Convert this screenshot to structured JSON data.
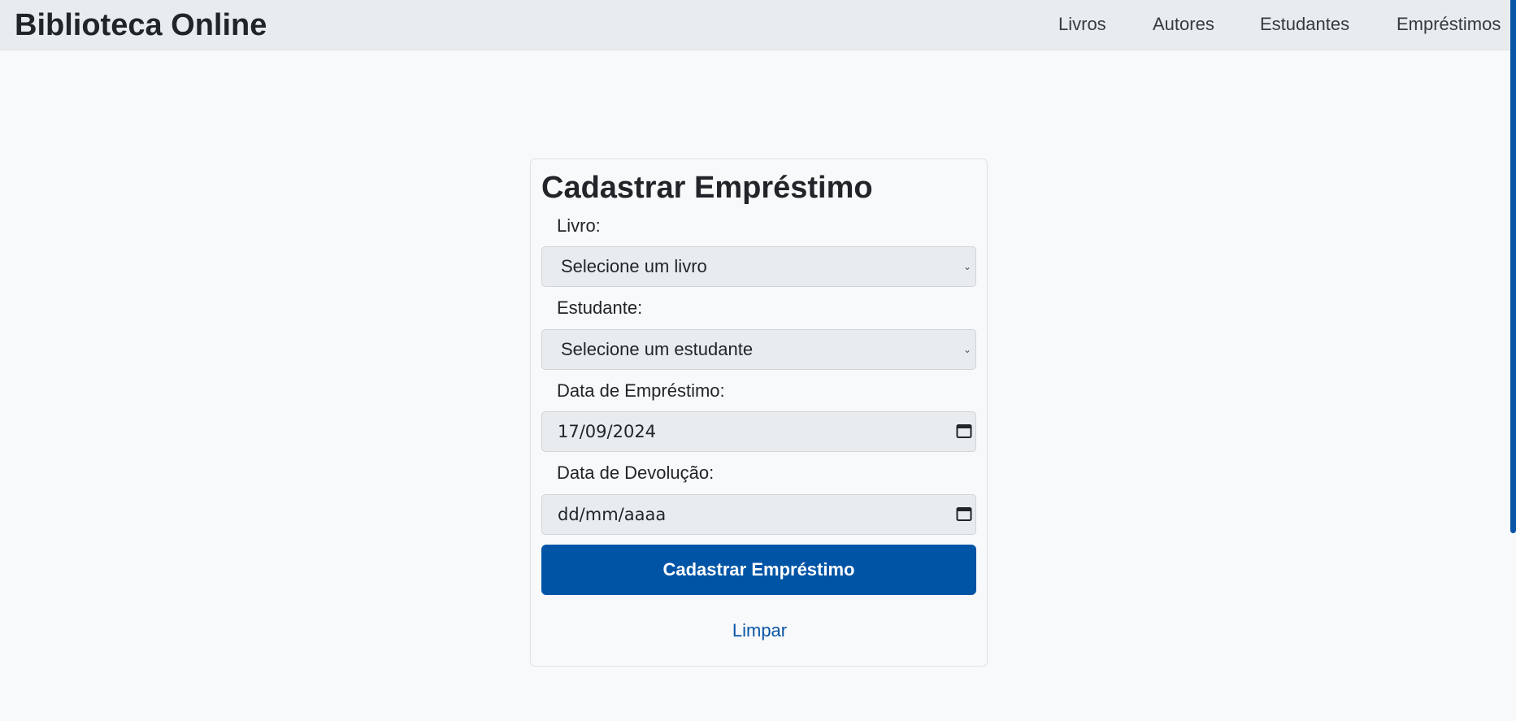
{
  "navbar": {
    "brand": "Biblioteca Online",
    "links": [
      "Livros",
      "Autores",
      "Estudantes",
      "Empréstimos"
    ]
  },
  "form": {
    "title": "Cadastrar Empréstimo",
    "livro": {
      "label": "Livro:",
      "selected": "Selecione um livro"
    },
    "estudante": {
      "label": "Estudante:",
      "selected": "Selecione um estudante"
    },
    "data_emprestimo": {
      "label": "Data de Empréstimo:",
      "value": "17/09/2024"
    },
    "data_devolucao": {
      "label": "Data de Devolução:",
      "value": "dd/mm/aaaa"
    },
    "submit_label": "Cadastrar Empréstimo",
    "clear_label": "Limpar"
  },
  "colors": {
    "primary": "#0054a6",
    "navbar_bg": "#e9ecef",
    "page_bg": "#f8f9fa"
  },
  "icons": {
    "select": "chevron-down-icon",
    "date": "calendar-icon"
  }
}
